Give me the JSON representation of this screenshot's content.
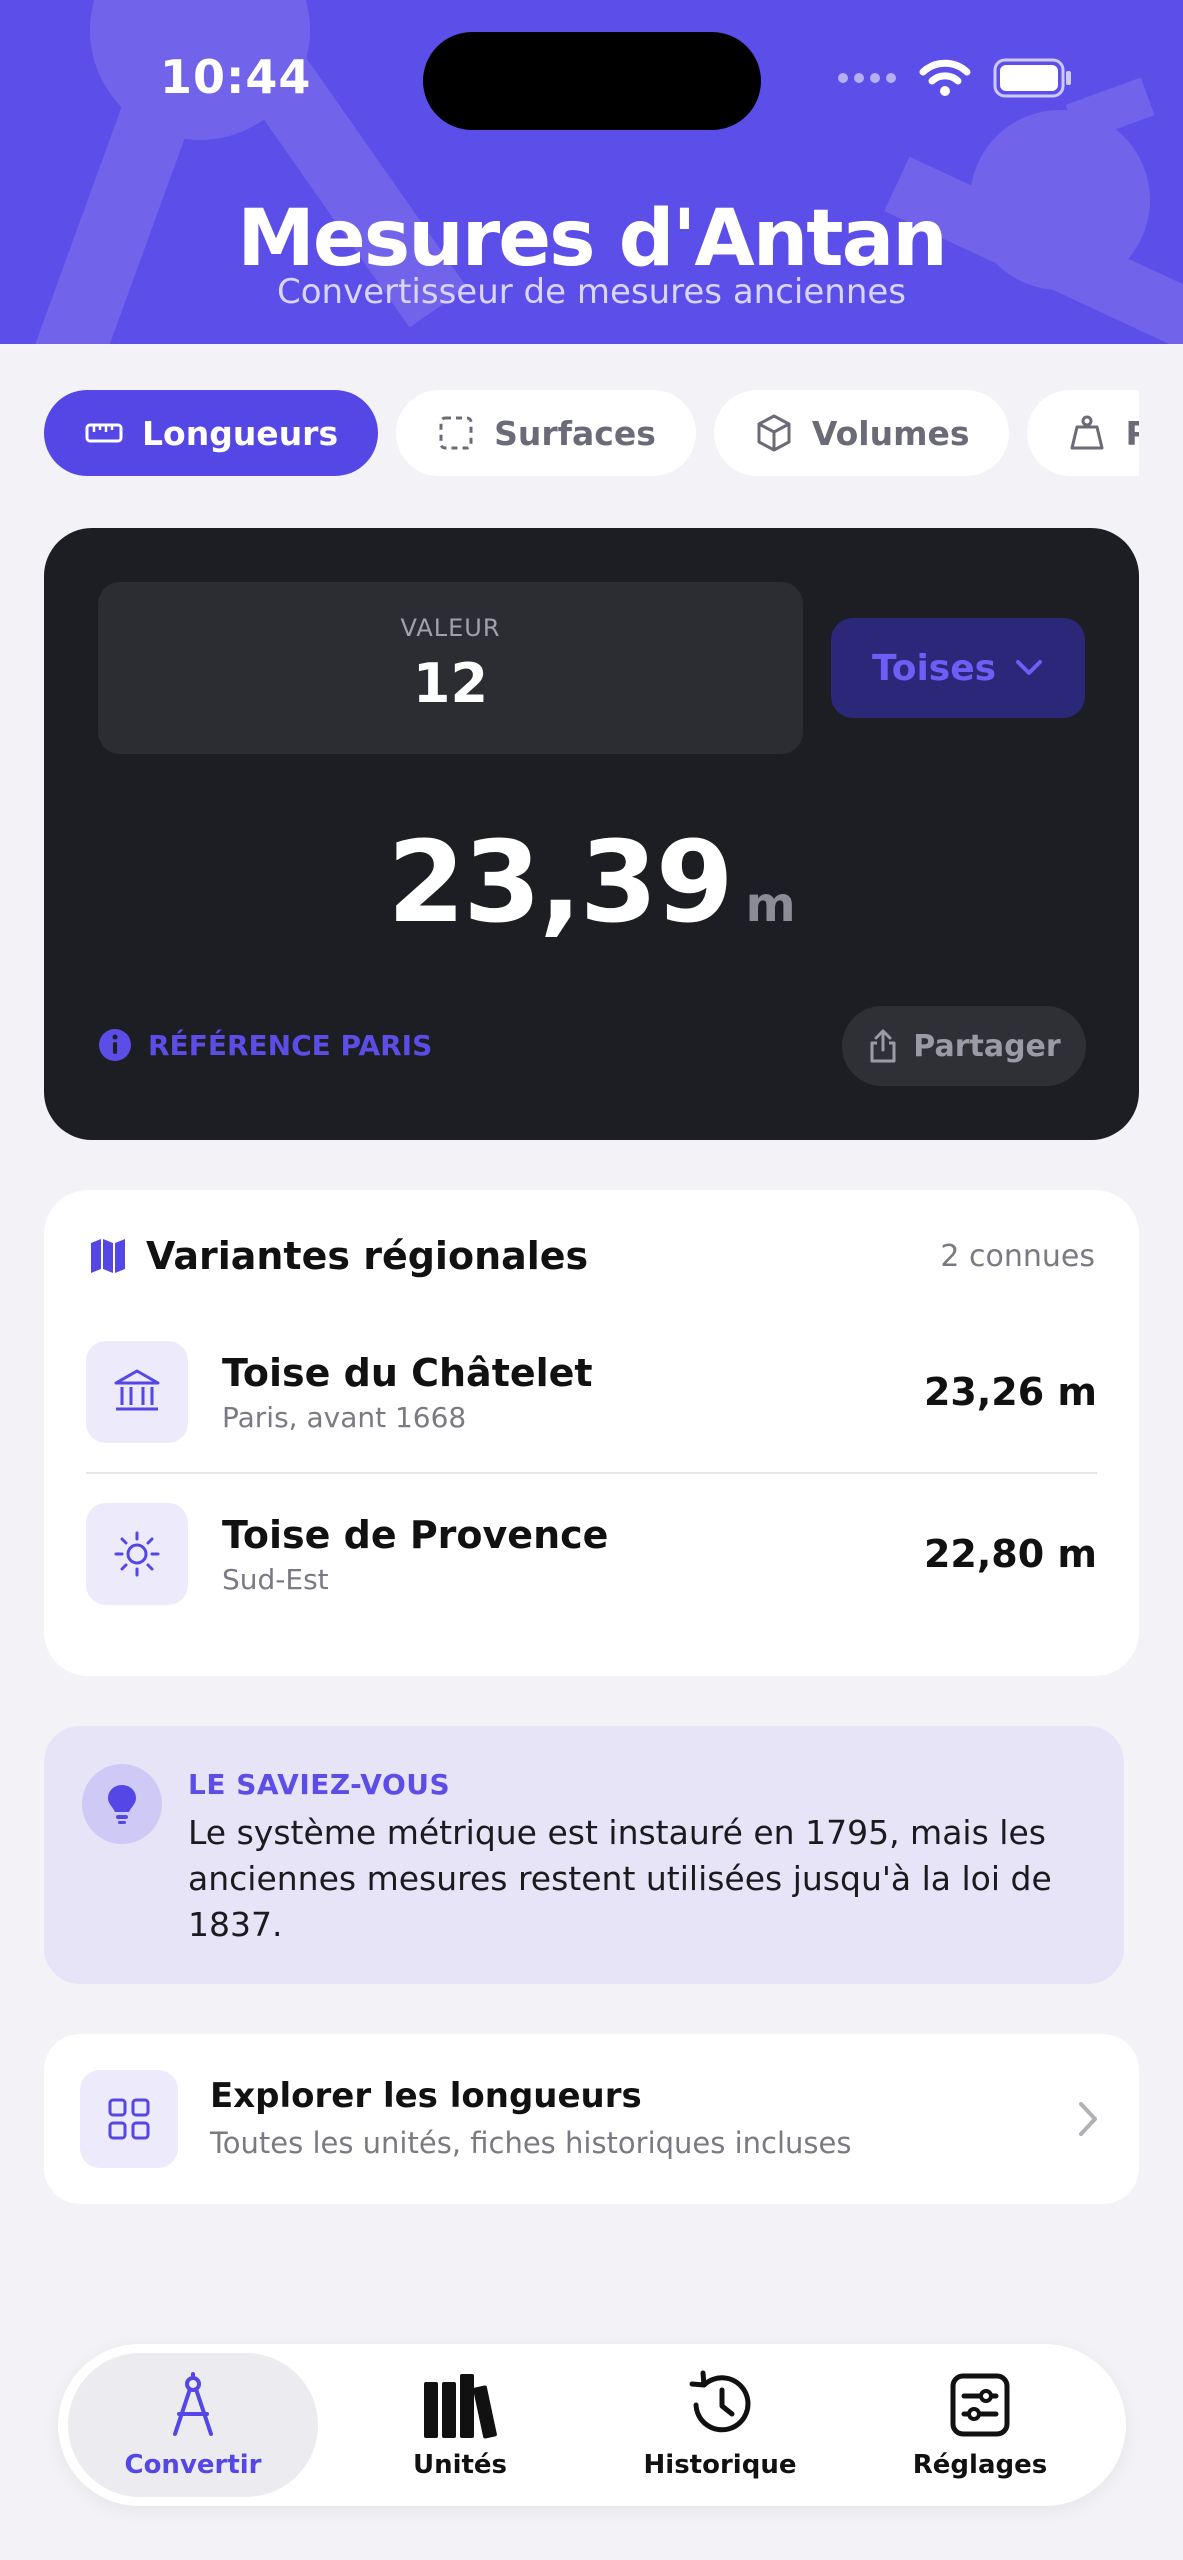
{
  "status_bar": {
    "time": "10:44"
  },
  "header": {
    "title": "Mesures d'Antan",
    "subtitle": "Convertisseur de mesures anciennes"
  },
  "tabs": [
    {
      "label": "Longueurs",
      "icon": "ruler-icon",
      "active": true
    },
    {
      "label": "Surfaces",
      "icon": "dashed-square-icon",
      "active": false
    },
    {
      "label": "Volumes",
      "icon": "cube-icon",
      "active": false
    },
    {
      "label": "Poids",
      "icon": "weight-icon",
      "active": false
    }
  ],
  "converter": {
    "value_label": "VALEUR",
    "value": "12",
    "unit": "Toises",
    "result_value": "23,39",
    "result_unit": "m",
    "reference": "RÉFÉRENCE PARIS",
    "share_label": "Partager"
  },
  "variants": {
    "title": "Variantes régionales",
    "count": "2 connues",
    "items": [
      {
        "name": "Toise du Châtelet",
        "sub": "Paris, avant 1668",
        "value": "23,26 m",
        "icon": "building-icon"
      },
      {
        "name": "Toise de Provence",
        "sub": "Sud-Est",
        "value": "22,80 m",
        "icon": "sun-icon"
      }
    ]
  },
  "tip": {
    "label": "LE SAVIEZ-VOUS",
    "text": "Le système métrique est instauré en 1795, mais les anciennes mesures restent utilisées jusqu'à la loi de 1837."
  },
  "explore": {
    "title": "Explorer les longueurs",
    "subtitle": "Toutes les unités, fiches historiques incluses"
  },
  "nav": [
    {
      "label": "Convertir",
      "icon": "compass-icon",
      "active": true
    },
    {
      "label": "Unités",
      "icon": "books-icon",
      "active": false
    },
    {
      "label": "Historique",
      "icon": "history-icon",
      "active": false
    },
    {
      "label": "Réglages",
      "icon": "settings-icon",
      "active": false
    }
  ],
  "colors": {
    "accent": "#5546e6",
    "header": "#5c4ee8",
    "card_dark": "#1d1e24",
    "background": "#f2f2f7"
  }
}
